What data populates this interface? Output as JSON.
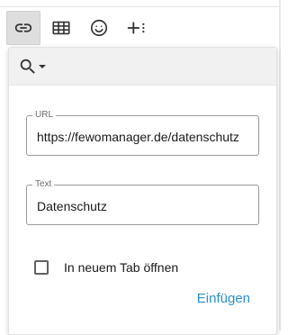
{
  "toolbar": {
    "buttons": [
      {
        "icon": "link-icon",
        "active": true
      },
      {
        "icon": "table-icon",
        "active": false
      },
      {
        "icon": "emoji-icon",
        "active": false
      },
      {
        "icon": "insert-more-icon",
        "active": false
      }
    ]
  },
  "popup": {
    "search_icon": "search-icon",
    "dropdown_icon": "caret-down-icon",
    "url_field": {
      "legend": "URL",
      "value": "https://fewomanager.de/datenschutz"
    },
    "text_field": {
      "legend": "Text",
      "value": "Datenschutz"
    },
    "new_tab": {
      "label": "In neuem Tab öffnen",
      "checked": false
    },
    "insert_label": "Einfügen"
  },
  "colors": {
    "accent": "#2b8fd3",
    "active_button_bg": "#dedede",
    "header_bg": "#f1f1f1"
  }
}
